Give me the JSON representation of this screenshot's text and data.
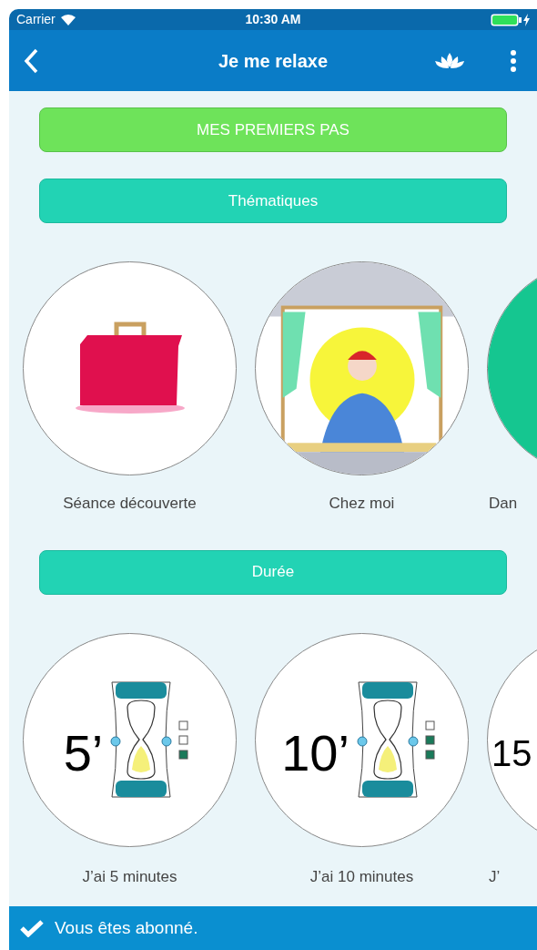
{
  "status_bar": {
    "carrier": "Carrier",
    "time": "10:30 AM"
  },
  "nav_bar": {
    "title": "Je me relaxe"
  },
  "first_steps_button": "MES PREMIERS PAS",
  "themes": {
    "header": "Thématiques",
    "items": [
      {
        "label": "Séance découverte",
        "kind": "kit"
      },
      {
        "label": "Chez moi",
        "kind": "window"
      },
      {
        "label": "Dan",
        "kind": "dark"
      }
    ]
  },
  "duration": {
    "header": "Durée",
    "items": [
      {
        "number": "5’",
        "label": "J’ai 5 minutes",
        "boxes": [
          false,
          false,
          true
        ]
      },
      {
        "number": "10’",
        "label": "J’ai 10 minutes",
        "boxes": [
          false,
          true,
          true
        ]
      },
      {
        "number": "15",
        "label": "J’"
      }
    ]
  },
  "footer": {
    "message": "Vous êtes abonné."
  }
}
